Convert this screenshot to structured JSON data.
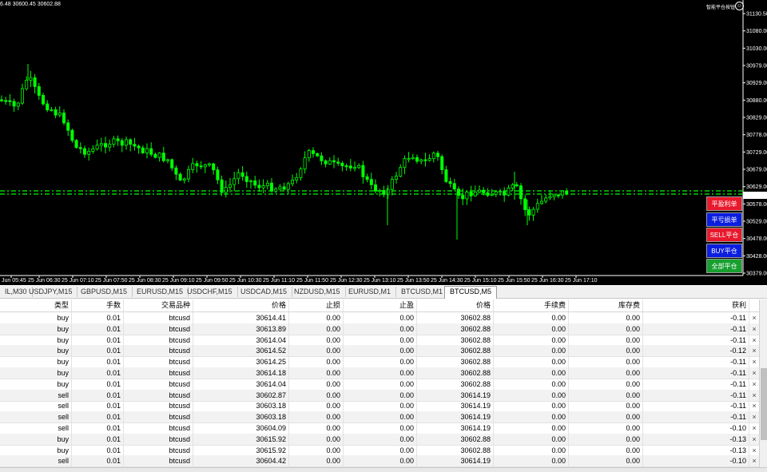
{
  "chart": {
    "quote_text": "6.48 30600.45 30602.88",
    "ea_label": "智能平仓按钮",
    "smile": "☺",
    "price_labels": [
      "31130.50",
      "31080.00",
      "31030.00",
      "30979.00",
      "30929.00",
      "30880.00",
      "30829.00",
      "30778.00",
      "30729.00",
      "30679.00",
      "30629.00",
      "30578.00",
      "30529.00",
      "30478.00",
      "30428.00",
      "30379.00"
    ],
    "current_price": "30602.88",
    "time_labels": [
      "Jun 05:45",
      "25 Jun 06:30",
      "25 Jun 07:10",
      "25 Jun 07:50",
      "25 Jun 08:30",
      "25 Jun 09:10",
      "25 Jun 09:50",
      "25 Jun 10:30",
      "25 Jun 11:10",
      "25 Jun 11:50",
      "25 Jun 12:30",
      "25 Jun 13:10",
      "25 Jun 13:50",
      "25 Jun 14:30",
      "25 Jun 15:10",
      "25 Jun 15:50",
      "25 Jun 16:30",
      "25 Jun 17:10"
    ],
    "candle_color": "#00ff00",
    "line_color": "#00ff00",
    "buttons": [
      {
        "label": "平盈利单",
        "color": "#e8192c"
      },
      {
        "label": "平亏损单",
        "color": "#0b1ee0"
      },
      {
        "label": "SELL平仓",
        "color": "#e8192c"
      },
      {
        "label": "BUY平仓",
        "color": "#0b1ee0"
      },
      {
        "label": "全部平仓",
        "color": "#17a030"
      }
    ]
  },
  "tabs": [
    "IL,M30",
    "USDJPY,M15",
    "GBPUSD,M15",
    "EURUSD,M15",
    "USDCHF,M15",
    "USDCAD,M15",
    "NZDUSD,M15",
    "EURUSD,M1",
    "BTCUSD,M1",
    "BTCUSD,M5"
  ],
  "active_tab": "BTCUSD,M5",
  "table": {
    "headers": [
      "类型",
      "手数",
      "交易品种",
      "价格",
      "止损",
      "止盈",
      "价格",
      "手续费",
      "库存费",
      "获利"
    ],
    "rows": [
      {
        "type": "buy",
        "lots": "0.01",
        "symbol": "btcusd",
        "price": "30614.41",
        "sl": "0.00",
        "tp": "0.00",
        "cur": "30602.88",
        "commission": "0.00",
        "swap": "0.00",
        "profit": "-0.11"
      },
      {
        "type": "buy",
        "lots": "0.01",
        "symbol": "btcusd",
        "price": "30613.89",
        "sl": "0.00",
        "tp": "0.00",
        "cur": "30602.88",
        "commission": "0.00",
        "swap": "0.00",
        "profit": "-0.11"
      },
      {
        "type": "buy",
        "lots": "0.01",
        "symbol": "btcusd",
        "price": "30614.04",
        "sl": "0.00",
        "tp": "0.00",
        "cur": "30602.88",
        "commission": "0.00",
        "swap": "0.00",
        "profit": "-0.11"
      },
      {
        "type": "buy",
        "lots": "0.01",
        "symbol": "btcusd",
        "price": "30614.52",
        "sl": "0.00",
        "tp": "0.00",
        "cur": "30602.88",
        "commission": "0.00",
        "swap": "0.00",
        "profit": "-0.12"
      },
      {
        "type": "buy",
        "lots": "0.01",
        "symbol": "btcusd",
        "price": "30614.25",
        "sl": "0.00",
        "tp": "0.00",
        "cur": "30602.88",
        "commission": "0.00",
        "swap": "0.00",
        "profit": "-0.11"
      },
      {
        "type": "buy",
        "lots": "0.01",
        "symbol": "btcusd",
        "price": "30614.18",
        "sl": "0.00",
        "tp": "0.00",
        "cur": "30602.88",
        "commission": "0.00",
        "swap": "0.00",
        "profit": "-0.11"
      },
      {
        "type": "buy",
        "lots": "0.01",
        "symbol": "btcusd",
        "price": "30614.04",
        "sl": "0.00",
        "tp": "0.00",
        "cur": "30602.88",
        "commission": "0.00",
        "swap": "0.00",
        "profit": "-0.11"
      },
      {
        "type": "sell",
        "lots": "0.01",
        "symbol": "btcusd",
        "price": "30602.87",
        "sl": "0.00",
        "tp": "0.00",
        "cur": "30614.19",
        "commission": "0.00",
        "swap": "0.00",
        "profit": "-0.11"
      },
      {
        "type": "sell",
        "lots": "0.01",
        "symbol": "btcusd",
        "price": "30603.18",
        "sl": "0.00",
        "tp": "0.00",
        "cur": "30614.19",
        "commission": "0.00",
        "swap": "0.00",
        "profit": "-0.11"
      },
      {
        "type": "sell",
        "lots": "0.01",
        "symbol": "btcusd",
        "price": "30603.18",
        "sl": "0.00",
        "tp": "0.00",
        "cur": "30614.19",
        "commission": "0.00",
        "swap": "0.00",
        "profit": "-0.11"
      },
      {
        "type": "sell",
        "lots": "0.01",
        "symbol": "btcusd",
        "price": "30604.09",
        "sl": "0.00",
        "tp": "0.00",
        "cur": "30614.19",
        "commission": "0.00",
        "swap": "0.00",
        "profit": "-0.10"
      },
      {
        "type": "buy",
        "lots": "0.01",
        "symbol": "btcusd",
        "price": "30615.92",
        "sl": "0.00",
        "tp": "0.00",
        "cur": "30602.88",
        "commission": "0.00",
        "swap": "0.00",
        "profit": "-0.13"
      },
      {
        "type": "buy",
        "lots": "0.01",
        "symbol": "btcusd",
        "price": "30615.92",
        "sl": "0.00",
        "tp": "0.00",
        "cur": "30602.88",
        "commission": "0.00",
        "swap": "0.00",
        "profit": "-0.13"
      },
      {
        "type": "sell",
        "lots": "0.01",
        "symbol": "btcusd",
        "price": "30604.42",
        "sl": "0.00",
        "tp": "0.00",
        "cur": "30614.19",
        "commission": "0.00",
        "swap": "0.00",
        "profit": "-0.10"
      }
    ],
    "close_icon": "×"
  }
}
